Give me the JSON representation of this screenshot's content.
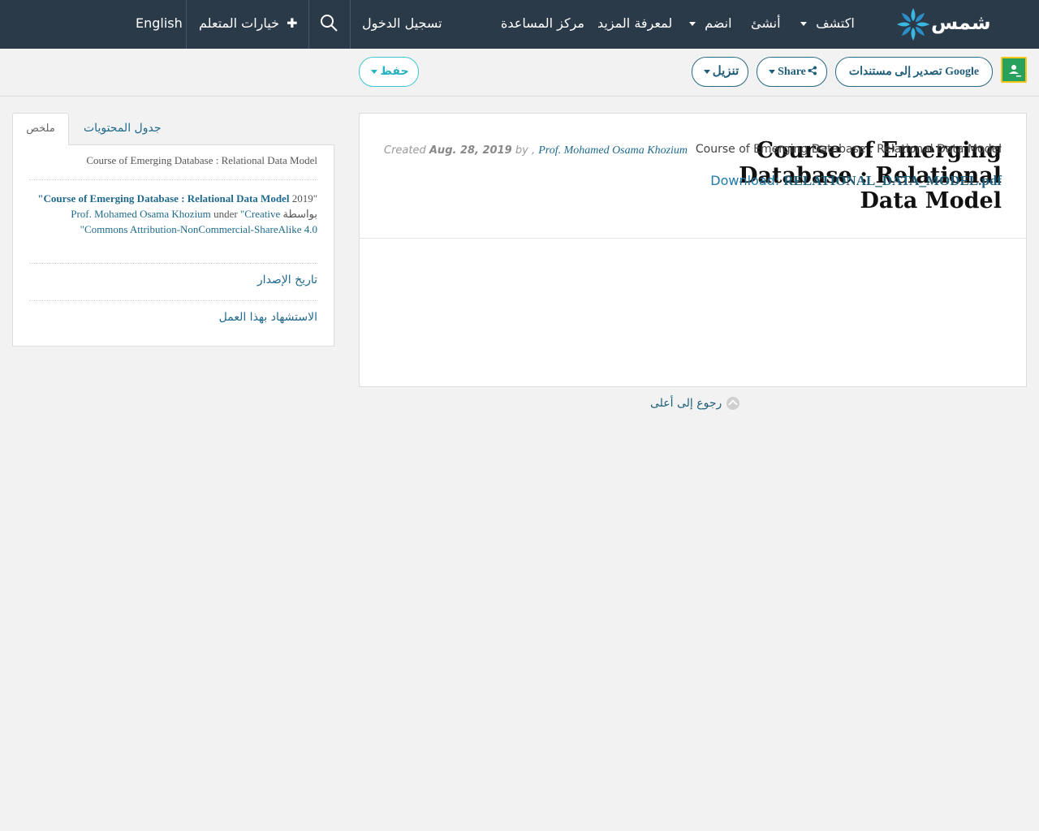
{
  "nav": {
    "logo_text": "شمس",
    "explore": "اكتشف",
    "create": "أنشئ",
    "join": "انضم",
    "learn_more": "لمعرفة المزيد",
    "help_center": "مركز المساعدة",
    "login": "تسجيل الدخول",
    "learner_options": "خيارات المتعلم",
    "language": "English"
  },
  "toolbar": {
    "export_google": "تصدير إلى مستندات Google",
    "share": "Share",
    "download": "تنزيل",
    "save": "حفظ"
  },
  "resource": {
    "title": "Course of Emerging Database : Relational Data Model",
    "created_label": "Created",
    "date": "Aug. 28, 2019",
    "by_label": "by",
    "comma": ",",
    "author": "Prof. Mohamed Osama Khozium",
    "description": "Course of Emerging Database : Relational Data Model",
    "download_label": "Download:",
    "download_file": "RELATIONAL_DATA_MODEL.pdf",
    "back_to_top": "رجوع إلى أعلى"
  },
  "side": {
    "tab_summary": "ملخص",
    "tab_toc": "جدول المحتويات",
    "summary": "Course of Emerging Database : Relational Data Model",
    "citation": {
      "year": "\"2019",
      "title": "Course of Emerging Database : Relational Data Model\"",
      "by": "بواسطة",
      "author": "Prof. Mohamed Osama Khozium",
      "under": "under",
      "license": "\"Creative Commons Attribution-NonCommercial-ShareAlike 4.0\""
    },
    "release_date": "تاريخ الإصدار",
    "cite_work": "الاستشهاد بهذا العمل"
  },
  "colors": {
    "navbar": "#2b3a49",
    "link": "#1f6a8c",
    "save_accent": "#26b2c1"
  }
}
